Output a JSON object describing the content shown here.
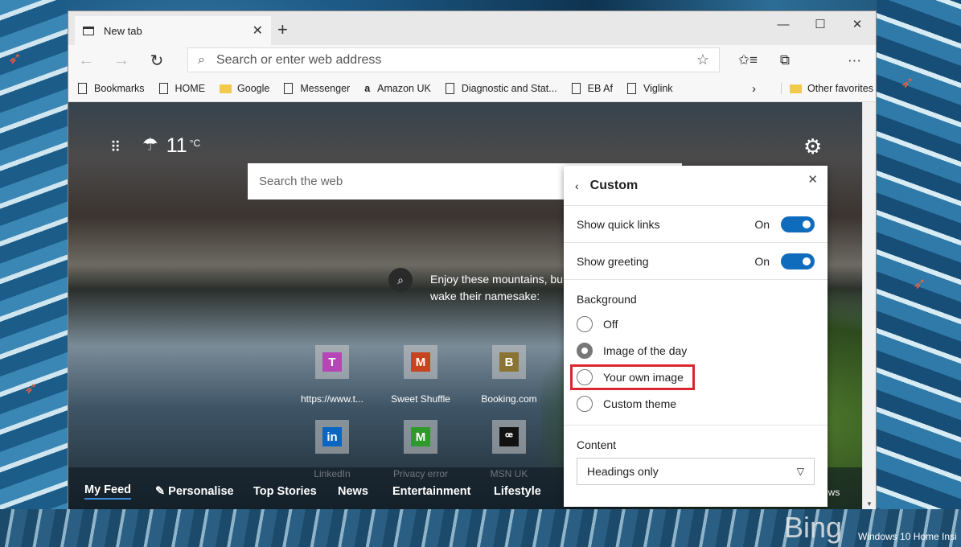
{
  "tab": {
    "title": "New tab",
    "close": "✕",
    "new": "+"
  },
  "window_controls": {
    "minimize": "—",
    "maximize": "☐",
    "close": "✕"
  },
  "toolbar": {
    "back": "←",
    "forward": "→",
    "refresh": "↻",
    "address_placeholder": "Search or enter web address",
    "star": "☆",
    "favorites": "✩≡",
    "collections": "⧉",
    "more": "···"
  },
  "bookmarks": [
    {
      "label": "Bookmarks",
      "icon": "page"
    },
    {
      "label": "HOME",
      "icon": "page"
    },
    {
      "label": "Google",
      "icon": "folder"
    },
    {
      "label": "Messenger",
      "icon": "page"
    },
    {
      "label": "Amazon UK",
      "icon": "amazon"
    },
    {
      "label": "Diagnostic and Stat...",
      "icon": "page"
    },
    {
      "label": "EB Af",
      "icon": "page"
    },
    {
      "label": "Viglink",
      "icon": "page"
    }
  ],
  "bookmarks_more": "›",
  "other_favorites": "Other favorites",
  "newtab": {
    "apps_icon": "⠿",
    "weather_icon": "☂",
    "temp": "11",
    "unit": "°C",
    "gear": "⚙",
    "search_placeholder": "Search the web",
    "info_icon": "⌕",
    "info_text": "Enjoy these mountains, bu wake their namesake:"
  },
  "quick_links": [
    {
      "label": "https://www.t...",
      "letter": "T",
      "color": "#b546b5"
    },
    {
      "label": "Sweet Shuffle",
      "letter": "M",
      "color": "#c6441f"
    },
    {
      "label": "Booking.com",
      "letter": "B",
      "color": "#8a7434"
    },
    {
      "label": "LinkedIn",
      "letter": "in",
      "color": "#0a66c2"
    },
    {
      "label": "Privacy error",
      "letter": "M",
      "color": "#2e9a2a"
    },
    {
      "label": "MSN UK",
      "letter": "ꟹ",
      "color": "#111111"
    }
  ],
  "feed_tabs": [
    "My Feed",
    "✎ Personalise",
    "Top Stories",
    "News",
    "Entertainment",
    "Lifestyle",
    "ews"
  ],
  "panel": {
    "back": "‹",
    "title": "Custom",
    "close": "✕",
    "rows": [
      {
        "label": "Show quick links",
        "state": "On"
      },
      {
        "label": "Show greeting",
        "state": "On"
      }
    ],
    "background_label": "Background",
    "options": [
      "Off",
      "Image of the day",
      "Your own image",
      "Custom theme"
    ],
    "selected": "Image of the day",
    "highlighted": "Your own image",
    "content_label": "Content",
    "content_value": "Headings only",
    "chev": "⌄"
  },
  "desktop": {
    "bing": "Bing",
    "os": "Windows 10 Home Insi"
  },
  "colors": {
    "accent": "#0f6cbd",
    "highlight": "#d9262f"
  }
}
